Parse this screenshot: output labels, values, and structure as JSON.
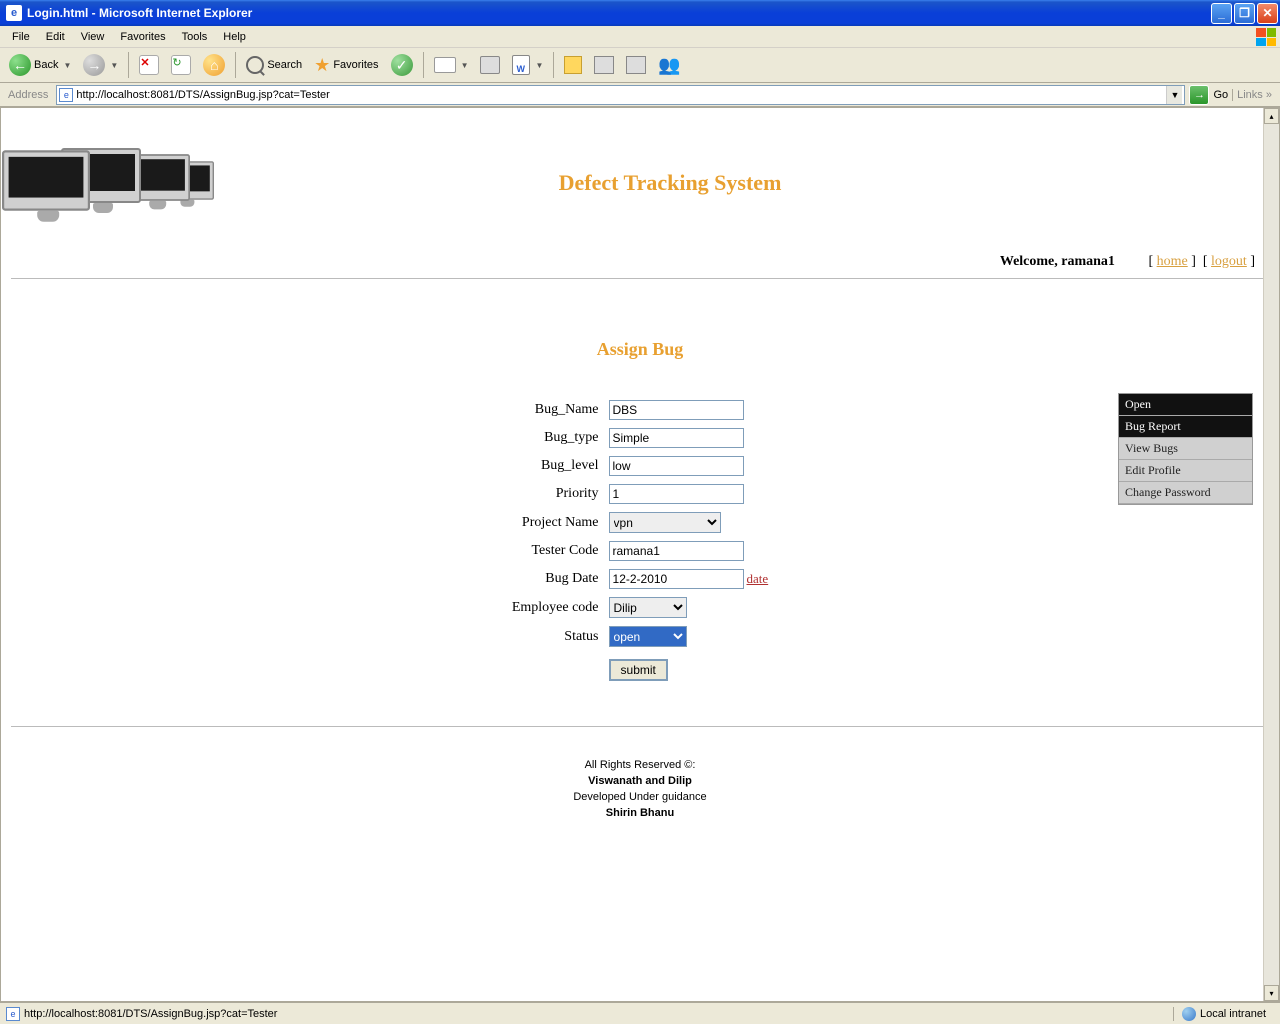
{
  "window": {
    "title": "Login.html - Microsoft Internet Explorer"
  },
  "menu": {
    "file": "File",
    "edit": "Edit",
    "view": "View",
    "favorites": "Favorites",
    "tools": "Tools",
    "help": "Help"
  },
  "toolbar": {
    "back": "Back",
    "search": "Search",
    "favorites": "Favorites"
  },
  "address": {
    "label": "Address",
    "url": "http://localhost:8081/DTS/AssignBug.jsp?cat=Tester",
    "go": "Go",
    "links": "Links"
  },
  "page": {
    "system_title": "Defect Tracking System",
    "welcome_prefix": "Welcome, ",
    "welcome_user": "ramana1",
    "home_link": "home",
    "logout_link": "logout",
    "form_title": "Assign Bug"
  },
  "sidebar": {
    "items": [
      {
        "label": "Open",
        "style": "dark"
      },
      {
        "label": "Bug Report",
        "style": "dark"
      },
      {
        "label": "View Bugs",
        "style": "light"
      },
      {
        "label": "Edit Profile",
        "style": "light"
      },
      {
        "label": "Change Password",
        "style": "light"
      }
    ]
  },
  "form": {
    "bug_name": {
      "label": "Bug_Name",
      "value": "DBS"
    },
    "bug_type": {
      "label": "Bug_type",
      "value": "Simple"
    },
    "bug_level": {
      "label": "Bug_level",
      "value": "low"
    },
    "priority": {
      "label": "Priority",
      "value": "1"
    },
    "project_name": {
      "label": "Project Name",
      "value": "vpn"
    },
    "tester_code": {
      "label": "Tester Code",
      "value": "ramana1"
    },
    "bug_date": {
      "label": "Bug Date",
      "value": "12-2-2010",
      "date_link": "date"
    },
    "employee_code": {
      "label": "Employee code",
      "value": "Dilip"
    },
    "status": {
      "label": "Status",
      "value": "open"
    },
    "submit": "submit"
  },
  "footer": {
    "line1": "All Rights Reserved ©:",
    "line2": "Viswanath and Dilip",
    "line3": "Developed Under guidance",
    "line4": "Shirin Bhanu"
  },
  "status": {
    "text": "http://localhost:8081/DTS/AssignBug.jsp?cat=Tester",
    "zone": "Local intranet"
  }
}
